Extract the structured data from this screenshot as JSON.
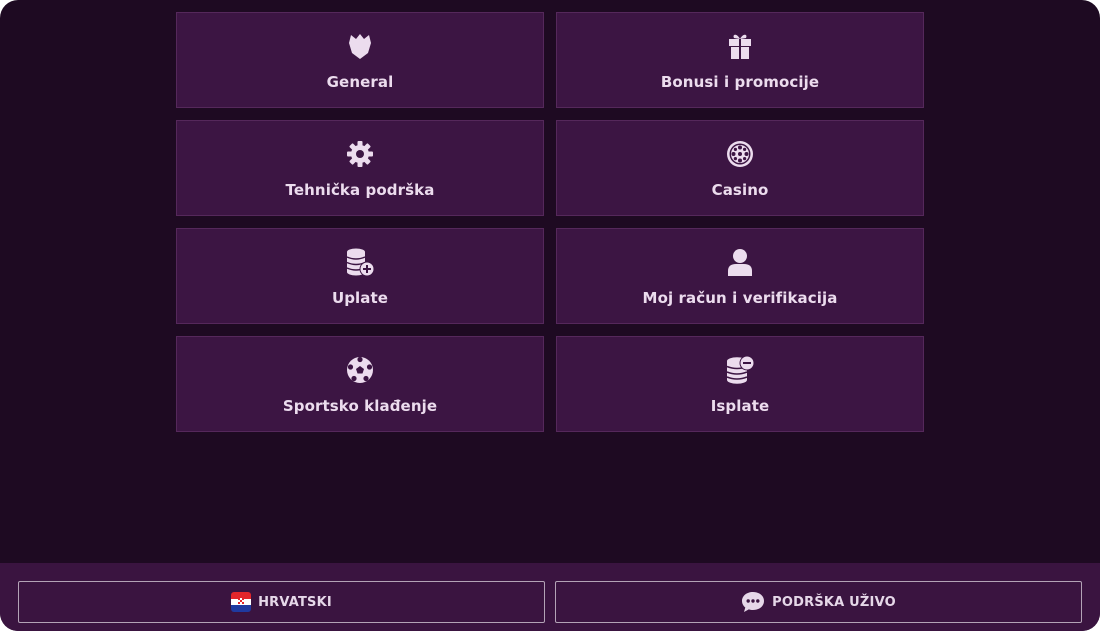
{
  "categories": [
    {
      "label": "General",
      "icon": "crest-icon"
    },
    {
      "label": "Bonusi i promocije",
      "icon": "gift-icon"
    },
    {
      "label": "Tehnička podrška",
      "icon": "gear-icon"
    },
    {
      "label": "Casino",
      "icon": "casino-chip-icon"
    },
    {
      "label": "Uplate",
      "icon": "coins-plus-icon"
    },
    {
      "label": "Moj račun i verifikacija",
      "icon": "user-icon"
    },
    {
      "label": "Sportsko klađenje",
      "icon": "soccer-ball-icon"
    },
    {
      "label": "Isplate",
      "icon": "coins-minus-icon"
    }
  ],
  "footer": {
    "language_label": "HRVATSKI",
    "language_icon": "croatia-flag-icon",
    "support_label": "PODRŠKA UŽIVO",
    "support_icon": "chat-bubble-icon"
  },
  "colors": {
    "background": "#1e0a22",
    "card": "#3c1543",
    "footer": "#3a1440",
    "text": "#ecdcee"
  }
}
